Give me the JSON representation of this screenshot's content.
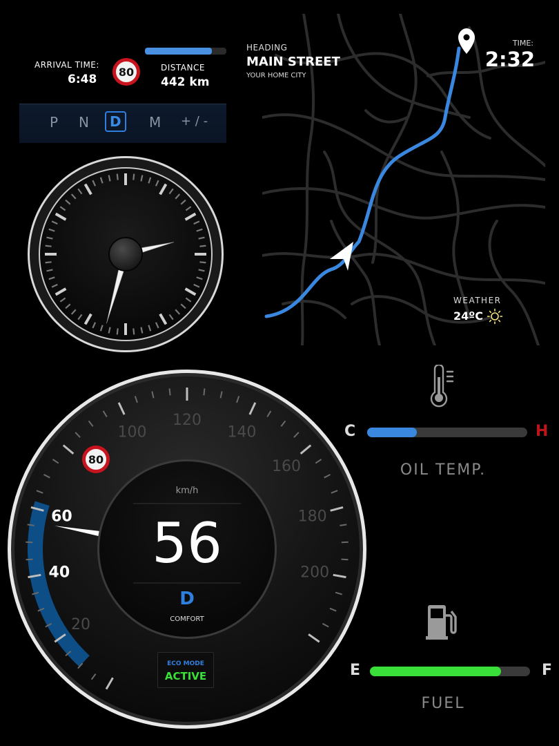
{
  "trip": {
    "arrival_label": "ARRIVAL TIME:",
    "arrival_value": "6:48",
    "speed_limit": "80",
    "distance_label": "DISTANCE",
    "distance_value": "442 km",
    "progress": 0.82
  },
  "gear_selector": {
    "gears": [
      "P",
      "N",
      "D",
      "M",
      "+ / -"
    ],
    "active": "D"
  },
  "navigation": {
    "heading_label": "HEADING",
    "street": "MAIN STREET",
    "city": "YOUR HOME CITY",
    "time_label": "TIME:",
    "time_value": "2:32",
    "weather_label": "WEATHER",
    "temperature": "24ºC",
    "weather_icon": "sun-icon",
    "route_color": "#3a87e0"
  },
  "clock": {
    "hour": 2,
    "minute": 32,
    "second": 34
  },
  "speedometer": {
    "speed": "56",
    "unit": "km/h",
    "gear": "D",
    "drive_mode": "COMFORT",
    "speed_limit": "80",
    "tick_labels": [
      "20",
      "40",
      "60",
      "100",
      "120",
      "140",
      "160",
      "180",
      "200"
    ],
    "eco_mode_label": "ECO MODE",
    "eco_mode_status": "ACTIVE"
  },
  "oil_temp": {
    "icon": "thermometer-icon",
    "cold_label": "C",
    "hot_label": "H",
    "level": 0.31,
    "label": "OIL TEMP.",
    "color": "#3a87e0"
  },
  "fuel": {
    "icon": "fuel-pump-icon",
    "empty_label": "E",
    "full_label": "F",
    "level": 0.82,
    "label": "FUEL",
    "color": "#39e03a"
  }
}
